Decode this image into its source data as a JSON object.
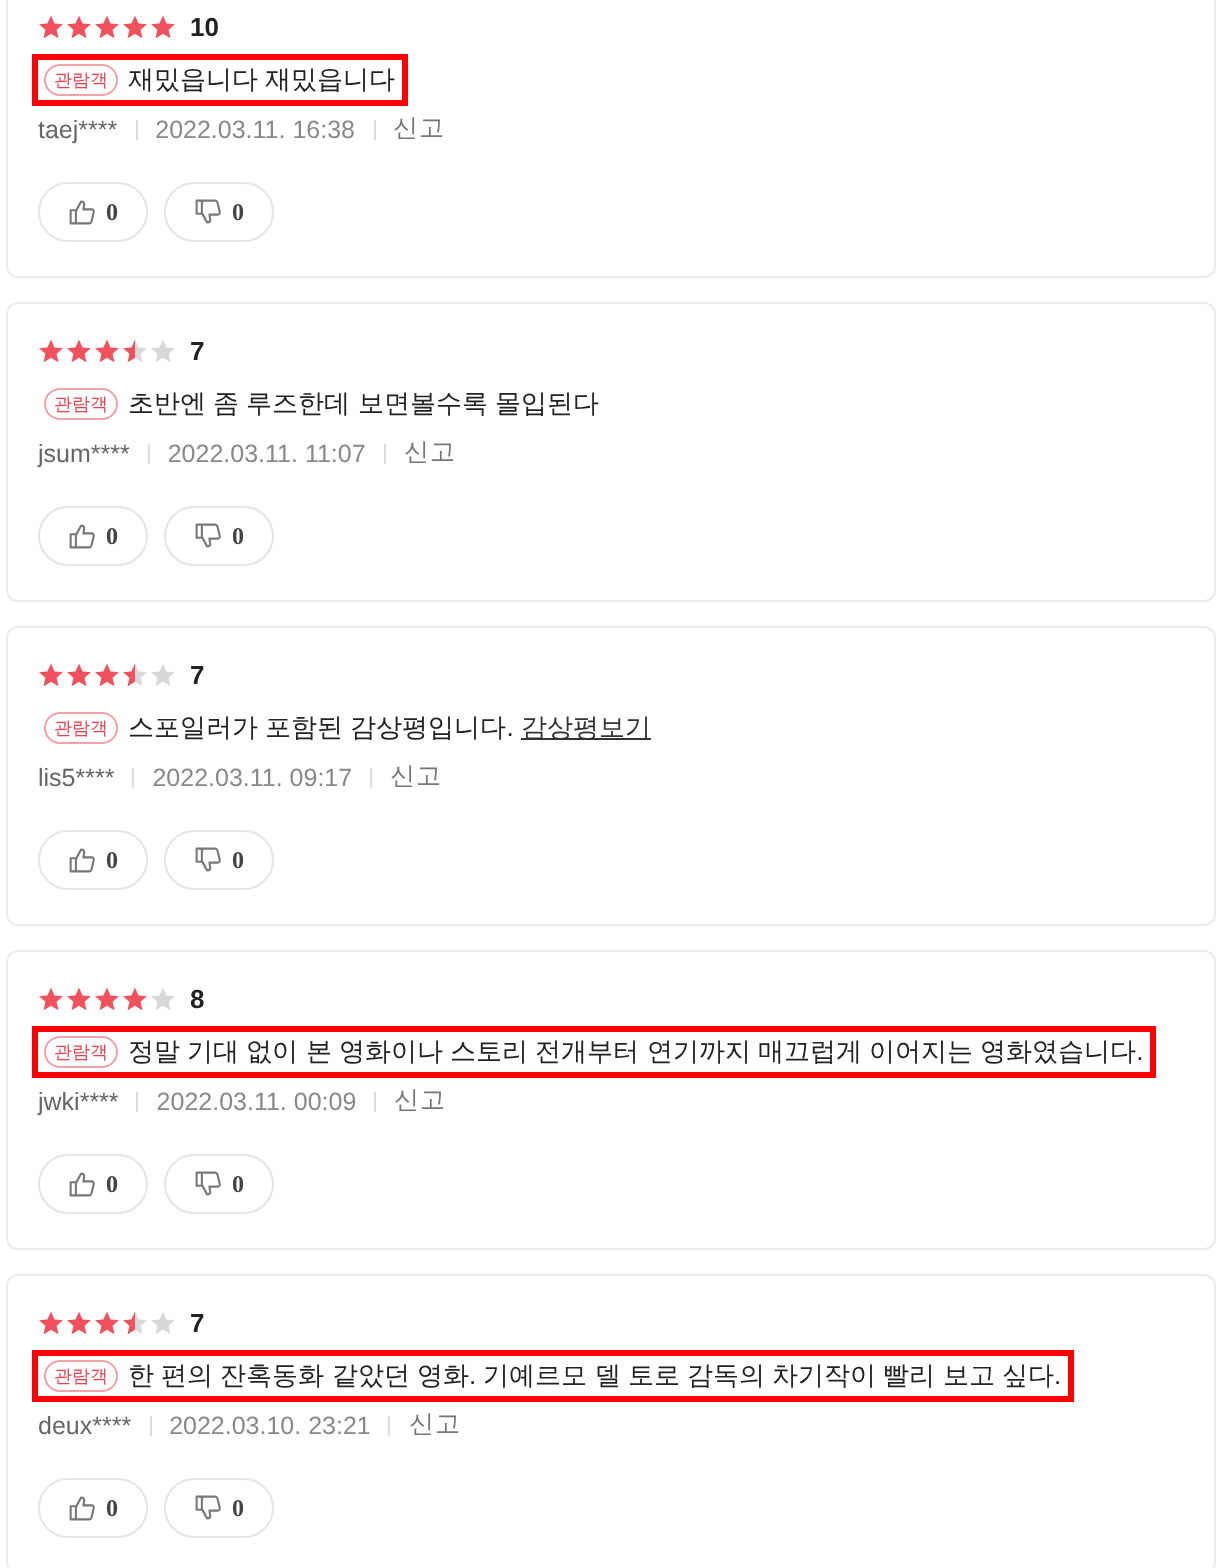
{
  "reviews": [
    {
      "stars": 5,
      "score": "10",
      "badge": "관람객",
      "text": "재밌읍니다 재밌읍니다",
      "highlighted": true,
      "user": "taej****",
      "date": "2022.03.11. 16:38",
      "report": "신고",
      "likes": "0",
      "dislikes": "0"
    },
    {
      "stars": 3.5,
      "score": "7",
      "badge": "관람객",
      "text": "초반엔 좀 루즈한데 보면볼수록 몰입된다",
      "highlighted": false,
      "user": "jsum****",
      "date": "2022.03.11. 11:07",
      "report": "신고",
      "likes": "0",
      "dislikes": "0"
    },
    {
      "stars": 3.5,
      "score": "7",
      "badge": "관람객",
      "text": "스포일러가 포함된 감상평입니다. ",
      "link": "감상평보기",
      "highlighted": false,
      "user": "lis5****",
      "date": "2022.03.11. 09:17",
      "report": "신고",
      "likes": "0",
      "dislikes": "0"
    },
    {
      "stars": 4,
      "score": "8",
      "badge": "관람객",
      "text": "정말 기대 없이 본 영화이나 스토리 전개부터 연기까지 매끄럽게 이어지는 영화였습니다.",
      "highlighted": true,
      "user": "jwki****",
      "date": "2022.03.11. 00:09",
      "report": "신고",
      "likes": "0",
      "dislikes": "0"
    },
    {
      "stars": 3.5,
      "score": "7",
      "badge": "관람객",
      "text": "한 편의 잔혹동화 같았던 영화. 기예르모 델 토로 감독의 차기작이 빨리 보고 싶다.",
      "highlighted": true,
      "user": "deux****",
      "date": "2022.03.10. 23:21",
      "report": "신고",
      "likes": "0",
      "dislikes": "0"
    }
  ]
}
